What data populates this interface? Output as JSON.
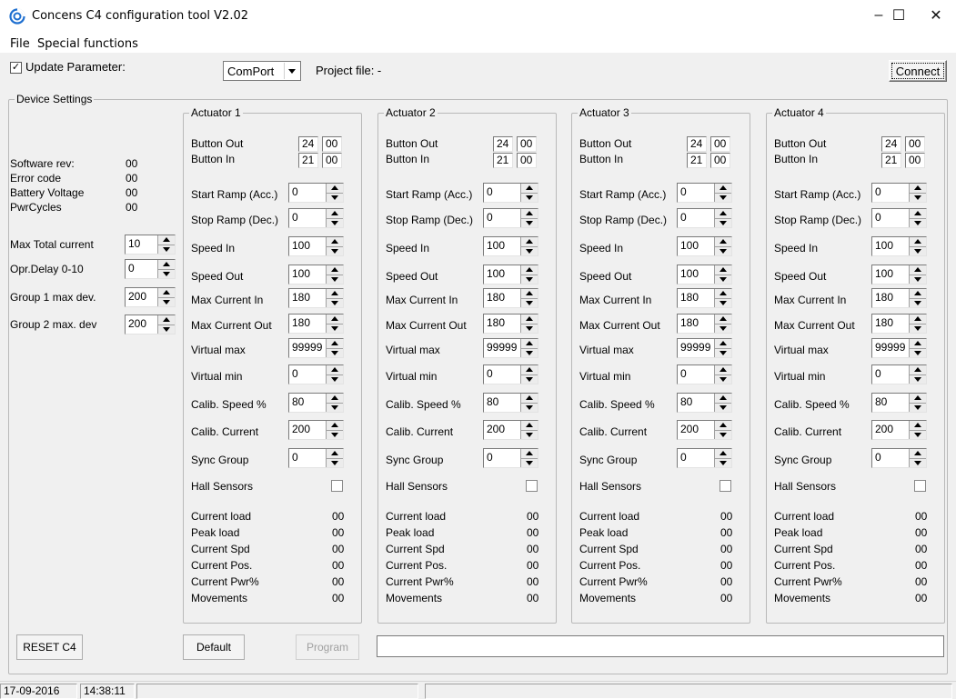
{
  "window": {
    "title": "Concens C4 configuration tool V2.02",
    "minimize": "–",
    "maximize": "☐",
    "close": "✕",
    "icon": "swirl-logo-icon",
    "accent": "#1e6fd0"
  },
  "menu": [
    "File",
    "Special functions"
  ],
  "toolbar": {
    "update_label": "Update Parameter:",
    "update_checked": "✓",
    "comport_value": "ComPort",
    "project_label": "Project file: -",
    "connect_label": "Connect"
  },
  "device": {
    "title": "Device Settings",
    "info": [
      {
        "label": "Software rev:",
        "value": "00"
      },
      {
        "label": "Error code",
        "value": "00"
      },
      {
        "label": "Battery Voltage",
        "value": "00"
      },
      {
        "label": "PwrCycles",
        "value": "00"
      }
    ],
    "params": [
      {
        "label": "Max Total current",
        "value": "10"
      },
      {
        "label": "Opr.Delay 0-10",
        "value": "0"
      },
      {
        "label": "Group 1 max dev.",
        "value": "200"
      },
      {
        "label": "Group 2 max. dev",
        "value": "200"
      }
    ]
  },
  "actuators": [
    {
      "title": "Actuator 1",
      "button_out": {
        "label": "Button Out",
        "a": "24",
        "b": "00"
      },
      "button_in": {
        "label": "Button In",
        "a": "21",
        "b": "00"
      },
      "params": [
        {
          "label": "Start Ramp (Acc.)",
          "value": "0"
        },
        {
          "label": "Stop Ramp (Dec.)",
          "value": "0"
        },
        {
          "label": "Speed In",
          "value": "100"
        },
        {
          "label": "Speed Out",
          "value": "100"
        },
        {
          "label": "Max Current In",
          "value": "180"
        },
        {
          "label": "Max Current Out",
          "value": "180"
        },
        {
          "label": "Virtual max",
          "value": "99999"
        },
        {
          "label": "Virtual min",
          "value": "0"
        },
        {
          "label": "Calib. Speed %",
          "value": "80"
        },
        {
          "label": "Calib. Current",
          "value": "200"
        },
        {
          "label": "Sync Group",
          "value": "0"
        }
      ],
      "hall_label": "Hall Sensors",
      "status": [
        {
          "label": "Current load",
          "value": "00"
        },
        {
          "label": "Peak load",
          "value": "00"
        },
        {
          "label": "Current Spd",
          "value": "00"
        },
        {
          "label": "Current Pos.",
          "value": "00"
        },
        {
          "label": "Current Pwr%",
          "value": "00"
        },
        {
          "label": "Movements",
          "value": "00"
        }
      ]
    },
    {
      "title": "Actuator 2",
      "button_out": {
        "label": "Button Out",
        "a": "24",
        "b": "00"
      },
      "button_in": {
        "label": "Button In",
        "a": "21",
        "b": "00"
      },
      "params": [
        {
          "label": "Start Ramp (Acc.)",
          "value": "0"
        },
        {
          "label": "Stop Ramp (Dec.)",
          "value": "0"
        },
        {
          "label": "Speed In",
          "value": "100"
        },
        {
          "label": "Speed Out",
          "value": "100"
        },
        {
          "label": "Max Current In",
          "value": "180"
        },
        {
          "label": "Max Current Out",
          "value": "180"
        },
        {
          "label": "Virtual max",
          "value": "99999"
        },
        {
          "label": "Virtual min",
          "value": "0"
        },
        {
          "label": "Calib. Speed %",
          "value": "80"
        },
        {
          "label": "Calib. Current",
          "value": "200"
        },
        {
          "label": "Sync Group",
          "value": "0"
        }
      ],
      "hall_label": "Hall Sensors",
      "status": [
        {
          "label": "Current load",
          "value": "00"
        },
        {
          "label": "Peak load",
          "value": "00"
        },
        {
          "label": "Current Spd",
          "value": "00"
        },
        {
          "label": "Current Pos.",
          "value": "00"
        },
        {
          "label": "Current Pwr%",
          "value": "00"
        },
        {
          "label": "Movements",
          "value": "00"
        }
      ]
    },
    {
      "title": "Actuator 3",
      "button_out": {
        "label": "Button Out",
        "a": "24",
        "b": "00"
      },
      "button_in": {
        "label": "Button In",
        "a": "21",
        "b": "00"
      },
      "params": [
        {
          "label": "Start Ramp (Acc.)",
          "value": "0"
        },
        {
          "label": "Stop Ramp (Dec.)",
          "value": "0"
        },
        {
          "label": "Speed In",
          "value": "100"
        },
        {
          "label": "Speed Out",
          "value": "100"
        },
        {
          "label": "Max Current In",
          "value": "180"
        },
        {
          "label": "Max Current Out",
          "value": "180"
        },
        {
          "label": "Virtual max",
          "value": "99999"
        },
        {
          "label": "Virtual min",
          "value": "0"
        },
        {
          "label": "Calib. Speed %",
          "value": "80"
        },
        {
          "label": "Calib. Current",
          "value": "200"
        },
        {
          "label": "Sync Group",
          "value": "0"
        }
      ],
      "hall_label": "Hall Sensors",
      "status": [
        {
          "label": "Current load",
          "value": "00"
        },
        {
          "label": "Peak load",
          "value": "00"
        },
        {
          "label": "Current Spd",
          "value": "00"
        },
        {
          "label": "Current Pos.",
          "value": "00"
        },
        {
          "label": "Current Pwr%",
          "value": "00"
        },
        {
          "label": "Movements",
          "value": "00"
        }
      ]
    },
    {
      "title": "Actuator 4",
      "button_out": {
        "label": "Button Out",
        "a": "24",
        "b": "00"
      },
      "button_in": {
        "label": "Button In",
        "a": "21",
        "b": "00"
      },
      "params": [
        {
          "label": "Start Ramp (Acc.)",
          "value": "0"
        },
        {
          "label": "Stop Ramp (Dec.)",
          "value": "0"
        },
        {
          "label": "Speed In",
          "value": "100"
        },
        {
          "label": "Speed Out",
          "value": "100"
        },
        {
          "label": "Max Current In",
          "value": "180"
        },
        {
          "label": "Max Current Out",
          "value": "180"
        },
        {
          "label": "Virtual max",
          "value": "99999"
        },
        {
          "label": "Virtual min",
          "value": "0"
        },
        {
          "label": "Calib. Speed %",
          "value": "80"
        },
        {
          "label": "Calib. Current",
          "value": "200"
        },
        {
          "label": "Sync Group",
          "value": "0"
        }
      ],
      "hall_label": "Hall Sensors",
      "status": [
        {
          "label": "Current load",
          "value": "00"
        },
        {
          "label": "Peak load",
          "value": "00"
        },
        {
          "label": "Current Spd",
          "value": "00"
        },
        {
          "label": "Current Pos.",
          "value": "00"
        },
        {
          "label": "Current Pwr%",
          "value": "00"
        },
        {
          "label": "Movements",
          "value": "00"
        }
      ]
    }
  ],
  "buttons": {
    "reset": "RESET C4",
    "default": "Default",
    "program": "Program"
  },
  "progress": 0,
  "statusbar": {
    "date": "17-09-2016",
    "time": "14:38:11"
  }
}
